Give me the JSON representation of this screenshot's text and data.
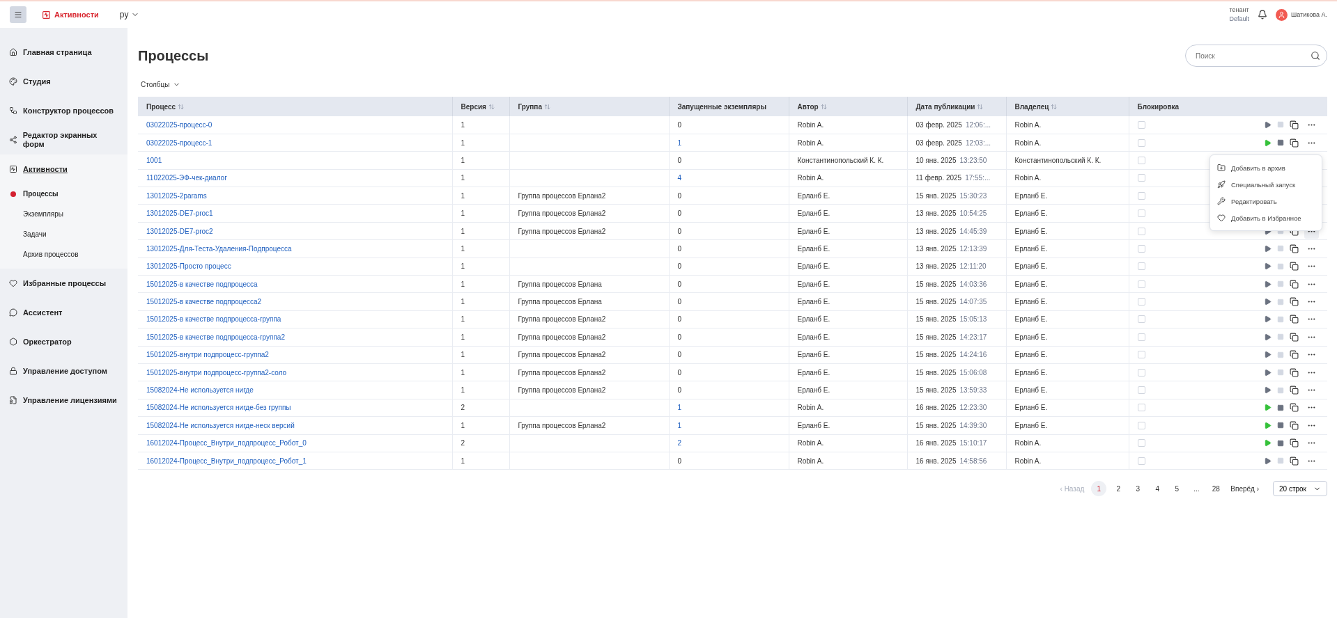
{
  "topbar": {
    "app_name": "Активности",
    "language": "ру",
    "tenant_label": "тенант",
    "tenant": "Default",
    "user": "Шатикова А."
  },
  "sidebar": {
    "items": [
      {
        "label": "Главная страница",
        "active": false
      },
      {
        "label": "Студия",
        "active": false
      },
      {
        "label": "Конструктор процессов",
        "active": false
      },
      {
        "label": "Редактор экранных форм",
        "active": false
      },
      {
        "label": "Активности",
        "active": true,
        "children": [
          {
            "label": "Процессы",
            "selected": true
          },
          {
            "label": "Экземпляры",
            "selected": false
          },
          {
            "label": "Задачи",
            "selected": false
          },
          {
            "label": "Архив процессов",
            "selected": false
          }
        ]
      },
      {
        "label": "Избранные процессы",
        "active": false
      },
      {
        "label": "Ассистент",
        "active": false
      },
      {
        "label": "Оркестратор",
        "active": false
      },
      {
        "label": "Управление доступом",
        "active": false
      },
      {
        "label": "Управление лицензиями",
        "active": false
      }
    ]
  },
  "page": {
    "title": "Процессы",
    "search": {
      "placeholder": "Поиск"
    },
    "columns_button": "Столбцы"
  },
  "table": {
    "columns": [
      {
        "label": "Процесс",
        "sortable": true
      },
      {
        "label": "Версия",
        "sortable": true
      },
      {
        "label": "Группа",
        "sortable": true
      },
      {
        "label": "Запущенные экземпляры",
        "sortable": false
      },
      {
        "label": "Автор",
        "sortable": true
      },
      {
        "label": "Дата публикации",
        "sortable": true
      },
      {
        "label": "Владелец",
        "sortable": true
      },
      {
        "label": "Блокировка",
        "sortable": false
      }
    ],
    "rows": [
      {
        "process": "03022025-процесс-0",
        "version": "1",
        "group": "",
        "instances": "0",
        "instances_link": false,
        "author": "Robin A.",
        "date": "03 февр. 2025",
        "time": "12:06:...",
        "owner": "Robin A.",
        "locked": false,
        "running": false,
        "more_active": false
      },
      {
        "process": "03022025-процесс-1",
        "version": "1",
        "group": "",
        "instances": "1",
        "instances_link": true,
        "author": "Robin A.",
        "date": "03 февр. 2025",
        "time": "12:03:...",
        "owner": "Robin A.",
        "locked": false,
        "running": true,
        "more_active": false
      },
      {
        "process": "1001",
        "version": "1",
        "group": "",
        "instances": "0",
        "instances_link": false,
        "author": "Константинопольский К. К.",
        "date": "10 янв. 2025",
        "time": "13:23:50",
        "owner": "Константинопольский К. К.",
        "locked": false
      },
      {
        "process": "11022025-ЭФ-чек-диалог",
        "version": "1",
        "group": "",
        "instances": "4",
        "instances_link": true,
        "author": "Robin A.",
        "date": "11 февр. 2025",
        "time": "17:55:...",
        "owner": "Robin A.",
        "locked": false
      },
      {
        "process": "13012025-2params",
        "version": "1",
        "group": "Группа процессов Ерлана2",
        "instances": "0",
        "instances_link": false,
        "author": "Ерланб Е.",
        "date": "15 янв. 2025",
        "time": "15:30:23",
        "owner": "Ерланб Е.",
        "locked": false
      },
      {
        "process": "13012025-DE7-proc1",
        "version": "1",
        "group": "Группа процессов Ерлана2",
        "instances": "0",
        "instances_link": false,
        "author": "Ерланб Е.",
        "date": "13 янв. 2025",
        "time": "10:54:25",
        "owner": "Ерланб Е.",
        "locked": false
      },
      {
        "process": "13012025-DE7-proc2",
        "version": "1",
        "group": "Группа процессов Ерлана2",
        "instances": "0",
        "instances_link": false,
        "author": "Ерланб Е.",
        "date": "13 янв. 2025",
        "time": "14:45:39",
        "owner": "Ерланб Е.",
        "locked": false,
        "running": false,
        "more_active": true
      },
      {
        "process": "13012025-Для-Теста-Удаления-Подпроцесса",
        "version": "1",
        "group": "",
        "instances": "0",
        "instances_link": false,
        "author": "Ерланб Е.",
        "date": "13 янв. 2025",
        "time": "12:13:39",
        "owner": "Ерланб Е.",
        "locked": false,
        "running": false,
        "more_active": false
      },
      {
        "process": "13012025-Просто процесс",
        "version": "1",
        "group": "",
        "instances": "0",
        "instances_link": false,
        "author": "Ерланб Е.",
        "date": "13 янв. 2025",
        "time": "12:11:20",
        "owner": "Ерланб Е.",
        "locked": false,
        "running": false,
        "more_active": false
      },
      {
        "process": "15012025-в качестве подпроцесса",
        "version": "1",
        "group": "Группа процессов Ерлана",
        "instances": "0",
        "instances_link": false,
        "author": "Ерланб Е.",
        "date": "15 янв. 2025",
        "time": "14:03:36",
        "owner": "Ерланб Е.",
        "locked": false,
        "running": false,
        "more_active": false
      },
      {
        "process": "15012025-в качестве подпроцесса2",
        "version": "1",
        "group": "Группа процессов Ерлана",
        "instances": "0",
        "instances_link": false,
        "author": "Ерланб Е.",
        "date": "15 янв. 2025",
        "time": "14:07:35",
        "owner": "Ерланб Е.",
        "locked": false,
        "running": false,
        "more_active": false
      },
      {
        "process": "15012025-в качестве подпроцесса-группа",
        "version": "1",
        "group": "Группа процессов Ерлана2",
        "instances": "0",
        "instances_link": false,
        "author": "Ерланб Е.",
        "date": "15 янв. 2025",
        "time": "15:05:13",
        "owner": "Ерланб Е.",
        "locked": false,
        "running": false,
        "more_active": false
      },
      {
        "process": "15012025-в качестве подпроцесса-группа2",
        "version": "1",
        "group": "Группа процессов Ерлана2",
        "instances": "0",
        "instances_link": false,
        "author": "Ерланб Е.",
        "date": "15 янв. 2025",
        "time": "14:23:17",
        "owner": "Ерланб Е.",
        "locked": false,
        "running": false,
        "more_active": false
      },
      {
        "process": "15012025-внутри подпроцесс-группа2",
        "version": "1",
        "group": "Группа процессов Ерлана2",
        "instances": "0",
        "instances_link": false,
        "author": "Ерланб Е.",
        "date": "15 янв. 2025",
        "time": "14:24:16",
        "owner": "Ерланб Е.",
        "locked": false,
        "running": false,
        "more_active": false
      },
      {
        "process": "15012025-внутри подпроцесс-группа2-соло",
        "version": "1",
        "group": "Группа процессов Ерлана2",
        "instances": "0",
        "instances_link": false,
        "author": "Ерланб Е.",
        "date": "15 янв. 2025",
        "time": "15:06:08",
        "owner": "Ерланб Е.",
        "locked": false,
        "running": false,
        "more_active": false
      },
      {
        "process": "15082024-Не используется нигде",
        "version": "1",
        "group": "Группа процессов Ерлана2",
        "instances": "0",
        "instances_link": false,
        "author": "Ерланб Е.",
        "date": "15 янв. 2025",
        "time": "13:59:33",
        "owner": "Ерланб Е.",
        "locked": false,
        "running": false,
        "more_active": false
      },
      {
        "process": "15082024-Не используется нигде-без группы",
        "version": "2",
        "group": "",
        "instances": "1",
        "instances_link": true,
        "author": "Robin A.",
        "date": "16 янв. 2025",
        "time": "12:23:30",
        "owner": "Ерланб Е.",
        "locked": false,
        "running": true,
        "more_active": false
      },
      {
        "process": "15082024-Не используется нигде-неск версий",
        "version": "1",
        "group": "Группа процессов Ерлана2",
        "instances": "1",
        "instances_link": true,
        "author": "Ерланб Е.",
        "date": "15 янв. 2025",
        "time": "14:39:30",
        "owner": "Ерланб Е.",
        "locked": false,
        "running": true,
        "more_active": false
      },
      {
        "process": "16012024-Процесс_Внутри_подпроцесс_Робот_0",
        "version": "2",
        "group": "",
        "instances": "2",
        "instances_link": true,
        "author": "Robin A.",
        "date": "16 янв. 2025",
        "time": "15:10:17",
        "owner": "Robin A.",
        "locked": false,
        "running": true,
        "more_active": false
      },
      {
        "process": "16012024-Процесс_Внутри_подпроцесс_Робот_1",
        "version": "1",
        "group": "",
        "instances": "0",
        "instances_link": false,
        "author": "Robin A.",
        "date": "16 янв. 2025",
        "time": "14:58:56",
        "owner": "Robin A.",
        "locked": false,
        "running": false,
        "more_active": false
      }
    ]
  },
  "context_menu": {
    "items": [
      "Добавить в архив",
      "Специальный запуск",
      "Редактировать",
      "Добавить в Избранное"
    ]
  },
  "pagination": {
    "prev": "‹ Назад",
    "prev_disabled": true,
    "pages": [
      {
        "label": "1",
        "selected": true
      },
      {
        "label": "2",
        "selected": false
      },
      {
        "label": "3",
        "selected": false
      },
      {
        "label": "4",
        "selected": false
      },
      {
        "label": "5",
        "selected": false
      },
      {
        "label": "...",
        "selected": false
      },
      {
        "label": "28",
        "selected": false
      }
    ],
    "next": "Вперёд ›",
    "page_size": "20 строк"
  }
}
